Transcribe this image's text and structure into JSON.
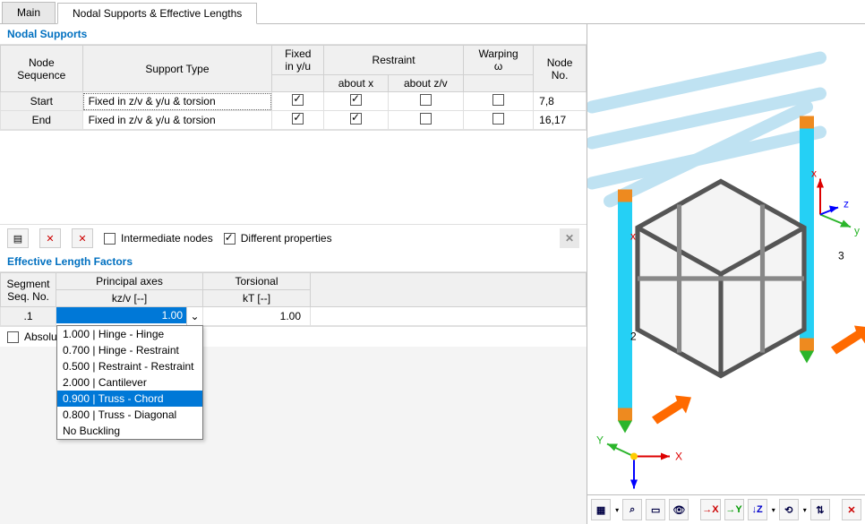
{
  "tabs": {
    "main": "Main",
    "sup": "Nodal Supports & Effective Lengths"
  },
  "nodal_supports": {
    "title": "Nodal Supports",
    "headers": {
      "seq": "Node\nSequence",
      "type": "Support Type",
      "fixed": "Fixed\nin y/u",
      "restraint": "Restraint",
      "about_x": "about x",
      "about_zv": "about z/v",
      "warping": "Warping\nω",
      "nodeno": "Node\nNo."
    },
    "rows": [
      {
        "seq": "Start",
        "type": "Fixed in z/v & y/u & torsion",
        "fixed": true,
        "ax": true,
        "azv": false,
        "w": false,
        "nodes": "7,8"
      },
      {
        "seq": "End",
        "type": "Fixed in z/v & y/u & torsion",
        "fixed": true,
        "ax": true,
        "azv": false,
        "w": false,
        "nodes": "16,17"
      }
    ],
    "intermediate": "Intermediate nodes",
    "different": "Different properties"
  },
  "elf": {
    "title": "Effective Length Factors",
    "headers": {
      "seg": "Segment\nSeq. No.",
      "principal": "Principal axes",
      "kzv": "kz/v [--]",
      "torsional": "Torsional",
      "kt": "kT [--]"
    },
    "row": {
      "seg": ".1",
      "kzv": "1.00",
      "kt": "1.00"
    },
    "dropdown": [
      "1.000 | Hinge - Hinge",
      "0.700 | Hinge - Restraint",
      "0.500 | Restraint - Restraint",
      "2.000 | Cantilever",
      "0.900 | Truss - Chord",
      "0.800 | Truss - Diagonal",
      "No Buckling"
    ],
    "absolute": "Absolu",
    "dropdown_selected_index": 4
  },
  "viewport": {
    "labels": {
      "x": "X",
      "y": "Y",
      "z": "Z",
      "n2": "2",
      "n3": "3"
    }
  },
  "toolbar_icons": [
    "▦",
    "⌕",
    "▭",
    "👁",
    "→X",
    "→Y",
    "↓Z",
    "⟲",
    "⇅",
    "✕"
  ]
}
